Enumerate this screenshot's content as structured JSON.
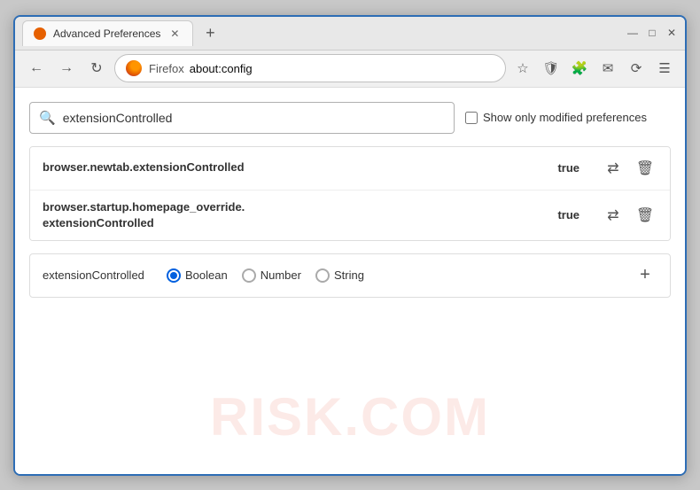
{
  "window": {
    "title": "Advanced Preferences",
    "new_tab_icon": "+",
    "controls": {
      "minimize": "—",
      "maximize": "□",
      "close": "✕"
    }
  },
  "toolbar": {
    "back_label": "←",
    "forward_label": "→",
    "reload_label": "↻",
    "browser_name": "Firefox",
    "address_url": "about:config",
    "bookmark_icon": "☆",
    "shield_icon": "🛡",
    "extension_icon": "🧩",
    "profile_icon": "✉",
    "sync_icon": "⟳",
    "menu_icon": "☰"
  },
  "search": {
    "placeholder": "extensionControlled",
    "value": "extensionControlled",
    "show_modified_label": "Show only modified preferences",
    "show_modified_checked": false
  },
  "results": [
    {
      "name": "browser.newtab.extensionControlled",
      "value": "true"
    },
    {
      "name": "browser.startup.homepage_override.\nextensionControlled",
      "name_line1": "browser.startup.homepage_override.",
      "name_line2": "extensionControlled",
      "value": "true",
      "multiline": true
    }
  ],
  "add_pref_row": {
    "name": "extensionControlled",
    "type_options": [
      {
        "label": "Boolean",
        "selected": true
      },
      {
        "label": "Number",
        "selected": false
      },
      {
        "label": "String",
        "selected": false
      }
    ],
    "add_btn_label": "+"
  },
  "watermark": {
    "text": "RISK.COM"
  },
  "icons": {
    "swap": "⇄",
    "delete": "🗑",
    "search": "🔍"
  }
}
